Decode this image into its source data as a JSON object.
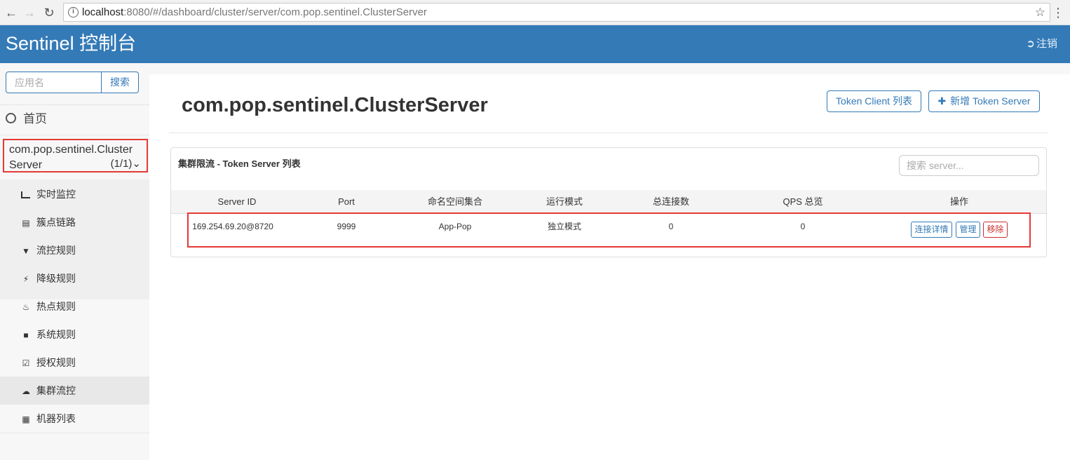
{
  "browser": {
    "back_icon": "arrow-left",
    "forward_icon": "arrow-right",
    "reload_icon": "reload",
    "url_host": "localhost",
    "url_rest": ":8080/#/dashboard/cluster/server/com.pop.sentinel.ClusterServer",
    "star_icon": "star"
  },
  "header": {
    "brand": "Sentinel 控制台",
    "logout_label": "注销",
    "color": "#337ab7"
  },
  "sidebar": {
    "search_placeholder": "应用名",
    "search_button": "搜索",
    "home_label": "首页",
    "app_name_line1": "com.pop.sentinel.Cluster",
    "app_name_line2": "Server",
    "app_count": "(1/1)",
    "items": [
      {
        "label": "实时监控",
        "icon": "bar-chart-icon"
      },
      {
        "label": "簇点链路",
        "icon": "list-icon"
      },
      {
        "label": "流控规则",
        "icon": "filter-icon"
      },
      {
        "label": "降级规则",
        "icon": "flash-icon"
      },
      {
        "label": "热点规则",
        "icon": "fire-icon"
      },
      {
        "label": "系统规则",
        "icon": "lock-icon"
      },
      {
        "label": "授权规则",
        "icon": "check-icon"
      },
      {
        "label": "集群流控",
        "icon": "cloud-icon"
      },
      {
        "label": "机器列表",
        "icon": "grid-list-icon"
      }
    ]
  },
  "main": {
    "title": "com.pop.sentinel.ClusterServer",
    "client_list_button": "Token Client 列表",
    "add_server_button": "新增 Token Server",
    "panel_title": "集群限流 - Token Server 列表",
    "panel_search_placeholder": "搜索 server...",
    "columns": [
      "Server ID",
      "Port",
      "命名空间集合",
      "运行模式",
      "总连接数",
      "QPS 总览",
      "操作"
    ],
    "rows": [
      {
        "server_id": "169.254.69.20@8720",
        "port": "9999",
        "namespaces": "App-Pop",
        "mode": "独立模式",
        "connections": "0",
        "qps": "0",
        "actions": [
          "连接详情",
          "管理",
          "移除"
        ]
      }
    ]
  }
}
